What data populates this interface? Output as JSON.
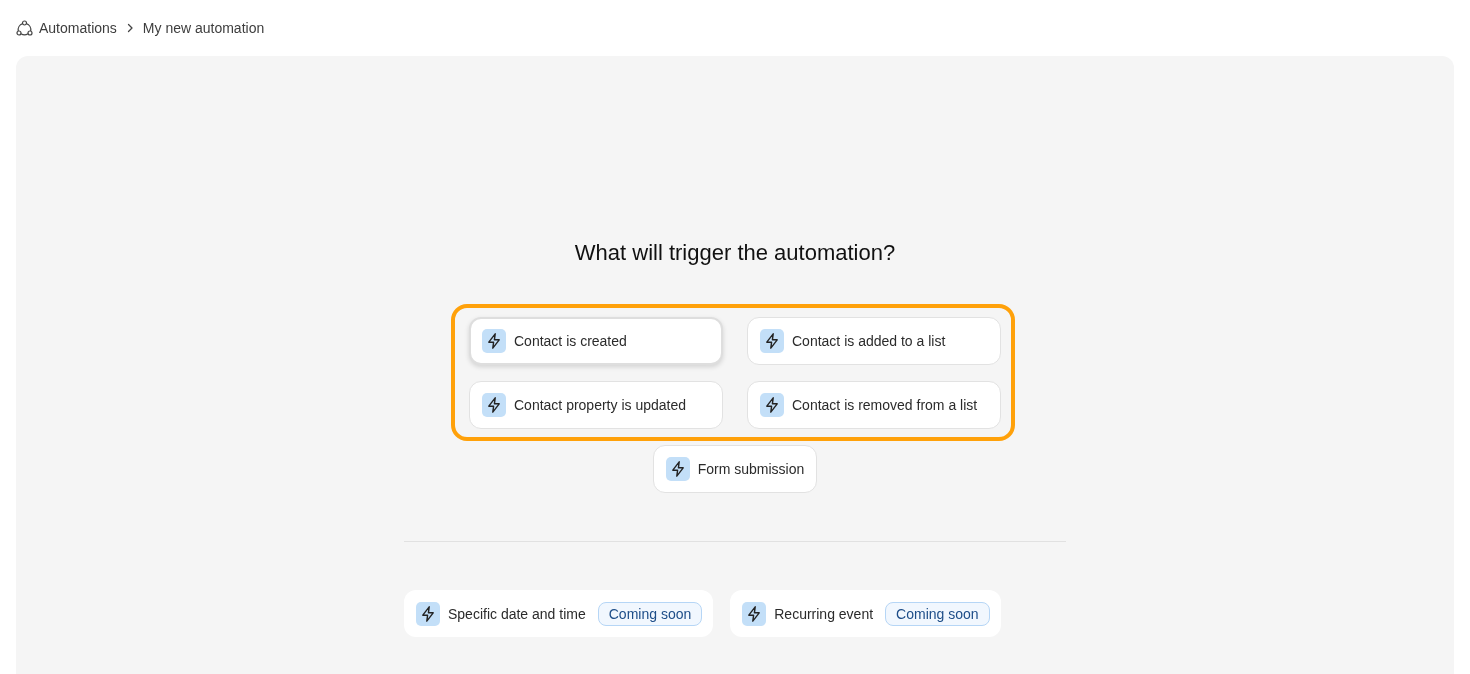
{
  "breadcrumb": {
    "parent": "Automations",
    "current": "My new automation"
  },
  "heading": "What will trigger the automation?",
  "trigger_sections": [
    {
      "outlined": true,
      "triggers": [
        {
          "label": "Contact is created",
          "hovered": true
        },
        {
          "label": "Contact is added to a list",
          "hovered": false
        },
        {
          "label": "Contact property is updated",
          "hovered": false
        },
        {
          "label": "Contact is removed from a list",
          "hovered": false
        }
      ]
    },
    {
      "outlined": false,
      "triggers": [
        {
          "label": "Form submission",
          "hovered": false
        }
      ]
    }
  ],
  "scheduled_triggers": [
    {
      "label": "Specific date and time",
      "badge": "Coming soon"
    },
    {
      "label": "Recurring event",
      "badge": "Coming soon"
    }
  ]
}
